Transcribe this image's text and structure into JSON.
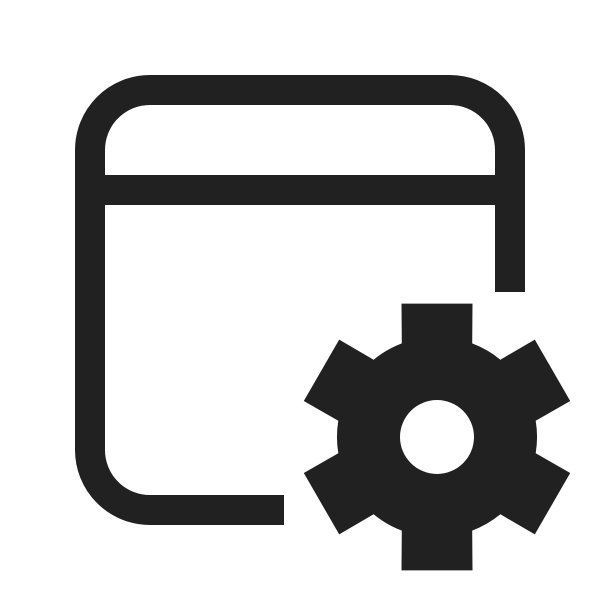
{
  "icon": {
    "name": "window-settings-icon",
    "components": [
      "window-frame-icon",
      "gear-icon"
    ],
    "stroke_color": "#212121",
    "background_color": "#ffffff"
  }
}
